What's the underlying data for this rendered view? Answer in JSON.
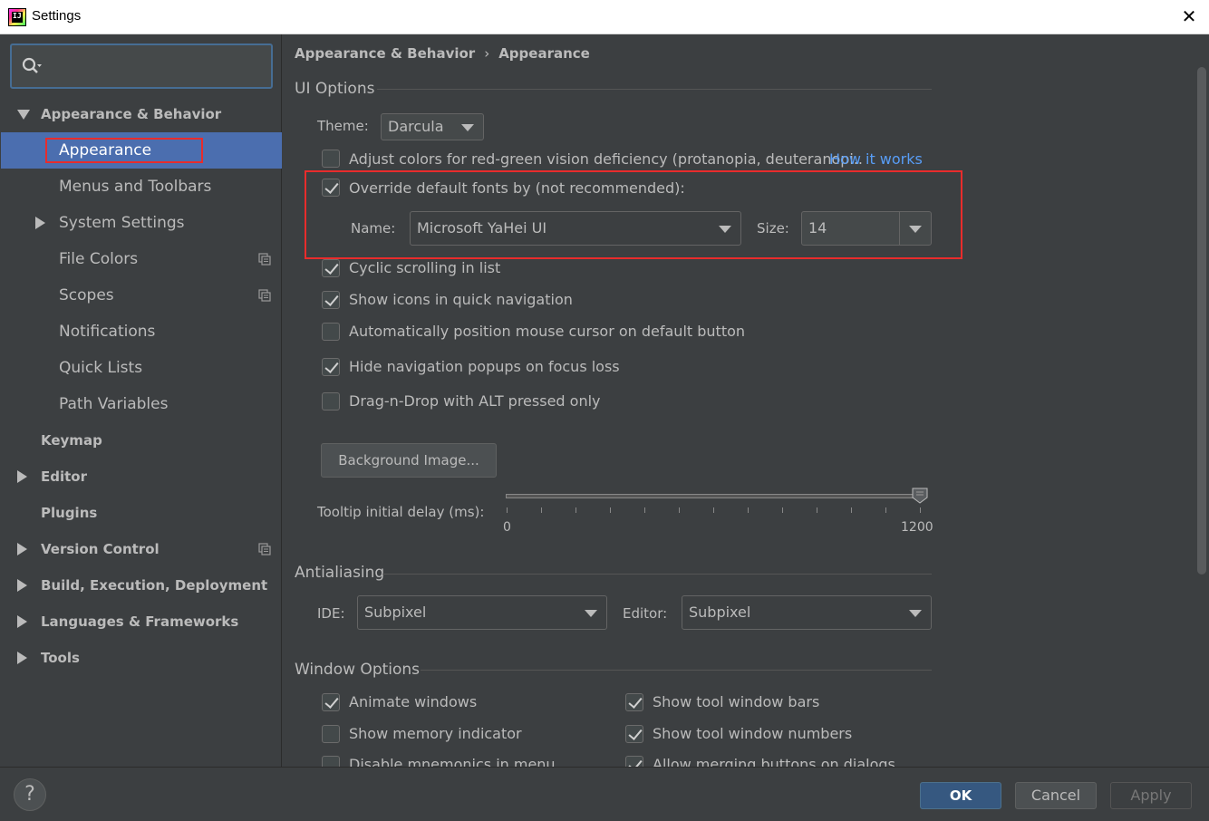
{
  "window": {
    "title": "Settings",
    "app_icon": "IJ"
  },
  "sidebar": {
    "search_placeholder": "",
    "items": [
      {
        "label": "Appearance & Behavior",
        "level": 0,
        "arrow": "down",
        "bold": true
      },
      {
        "label": "Appearance",
        "level": 1,
        "selected": true
      },
      {
        "label": "Menus and Toolbars",
        "level": 1
      },
      {
        "label": "System Settings",
        "level": 1,
        "arrow": "right"
      },
      {
        "label": "File Colors",
        "level": 1,
        "copy_icon": true
      },
      {
        "label": "Scopes",
        "level": 1,
        "copy_icon": true
      },
      {
        "label": "Notifications",
        "level": 1
      },
      {
        "label": "Quick Lists",
        "level": 1
      },
      {
        "label": "Path Variables",
        "level": 1
      },
      {
        "label": "Keymap",
        "level": 0,
        "bold": true
      },
      {
        "label": "Editor",
        "level": 0,
        "arrow": "right",
        "bold": true
      },
      {
        "label": "Plugins",
        "level": 0,
        "bold": true
      },
      {
        "label": "Version Control",
        "level": 0,
        "arrow": "right",
        "bold": true,
        "copy_icon": true
      },
      {
        "label": "Build, Execution, Deployment",
        "level": 0,
        "arrow": "right",
        "bold": true
      },
      {
        "label": "Languages & Frameworks",
        "level": 0,
        "arrow": "right",
        "bold": true
      },
      {
        "label": "Tools",
        "level": 0,
        "arrow": "right",
        "bold": true
      }
    ]
  },
  "breadcrumb": {
    "parent": "Appearance & Behavior",
    "separator": "›",
    "current": "Appearance"
  },
  "ui_options": {
    "title": "UI Options",
    "theme_label": "Theme:",
    "theme_value": "Darcula",
    "adjust_colors": {
      "label": "Adjust colors for red-green vision deficiency (protanopia, deuteranopi..",
      "checked": false
    },
    "how_it_works": "How it works",
    "override_fonts": {
      "label": "Override default fonts by (not recommended):",
      "checked": true
    },
    "name_label": "Name:",
    "name_value": "Microsoft YaHei UI",
    "size_label": "Size:",
    "size_value": "14",
    "cyclic_scrolling": {
      "label": "Cyclic scrolling in list",
      "checked": true
    },
    "show_icons": {
      "label": "Show icons in quick navigation",
      "checked": true
    },
    "auto_position": {
      "label": "Automatically position mouse cursor on default button",
      "checked": false
    },
    "hide_popups": {
      "label": "Hide navigation popups on focus loss",
      "checked": true
    },
    "drag_n_drop": {
      "label": "Drag-n-Drop with ALT pressed only",
      "checked": false
    },
    "background_image_button": "Background Image...",
    "tooltip_label": "Tooltip initial delay (ms):",
    "tooltip_min": "0",
    "tooltip_max": "1200",
    "tooltip_value": 1200
  },
  "antialiasing": {
    "title": "Antialiasing",
    "ide_label": "IDE:",
    "ide_value": "Subpixel",
    "editor_label": "Editor:",
    "editor_value": "Subpixel"
  },
  "window_options": {
    "title": "Window Options",
    "animate_windows": {
      "label": "Animate windows",
      "checked": true
    },
    "show_memory": {
      "label": "Show memory indicator",
      "checked": false
    },
    "disable_mnemonics": {
      "label": "Disable mnemonics in menu",
      "checked": false
    },
    "show_tool_bars": {
      "label": "Show tool window bars",
      "checked": true
    },
    "show_tool_numbers": {
      "label": "Show tool window numbers",
      "checked": true
    },
    "allow_merging": {
      "label": "Allow merging buttons on dialogs",
      "checked": true
    }
  },
  "buttons": {
    "help": "?",
    "ok": "OK",
    "cancel": "Cancel",
    "apply": "Apply"
  },
  "colors": {
    "accent": "#4b6eaf",
    "highlight_border": "#e82c2c",
    "link": "#589df6",
    "background": "#3c3f41"
  }
}
